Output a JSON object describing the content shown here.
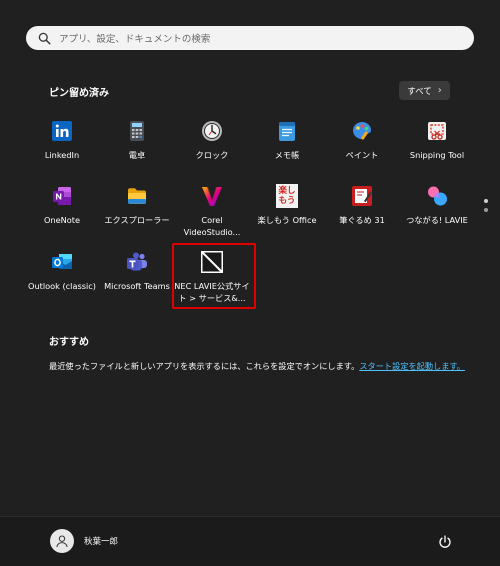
{
  "search": {
    "placeholder": "アプリ、設定、ドキュメントの検索"
  },
  "pinned": {
    "title": "ピン留め済み",
    "all_button": "すべて",
    "apps": [
      {
        "label": "LinkedIn",
        "icon": "linkedin-icon"
      },
      {
        "label": "電卓",
        "icon": "calculator-icon"
      },
      {
        "label": "クロック",
        "icon": "clock-icon"
      },
      {
        "label": "メモ帳",
        "icon": "notepad-icon"
      },
      {
        "label": "ペイント",
        "icon": "paint-icon"
      },
      {
        "label": "Snipping Tool",
        "icon": "snipping-tool-icon"
      },
      {
        "label": "OneNote",
        "icon": "onenote-icon"
      },
      {
        "label": "エクスプローラー",
        "icon": "file-explorer-icon"
      },
      {
        "label": "Corel VideoStudio...",
        "icon": "corel-videostudio-icon"
      },
      {
        "label": "楽しもう Office",
        "icon": "office-icon"
      },
      {
        "label": "筆ぐるめ 31",
        "icon": "fudegurume-icon"
      },
      {
        "label": "つながる! LAVIE",
        "icon": "lavie-connect-icon"
      },
      {
        "label": "Outlook (classic)",
        "icon": "outlook-icon"
      },
      {
        "label": "Microsoft Teams",
        "icon": "teams-icon"
      },
      {
        "label": "NEC LAVIE公式サイト > サービス&...",
        "icon": "nec-lavie-site-icon"
      }
    ],
    "icon_text": {
      "office": [
        "楽し",
        "もう"
      ]
    }
  },
  "recommended": {
    "title": "おすすめ",
    "message": "最近使ったファイルと新しいアプリを表示するには、これらを設定でオンにします。",
    "link": "スタート設定を起動します。"
  },
  "footer": {
    "username": "秋葉一郎"
  },
  "colors": {
    "background": "#202020",
    "link": "#4cc2ff",
    "highlight": "#e00000"
  }
}
